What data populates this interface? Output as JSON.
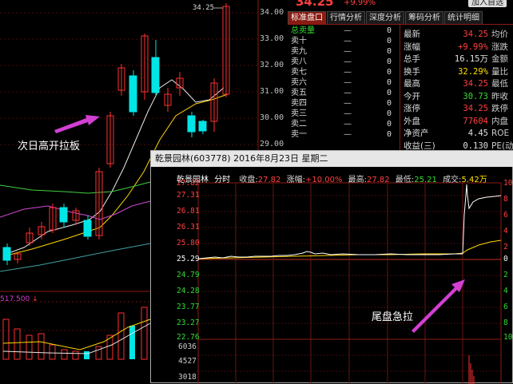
{
  "main_chart": {
    "y_labels": [
      "34.00",
      "33.00",
      "32.00",
      "31.00",
      "30.00",
      "29.00"
    ],
    "peak_label": "34.25",
    "annotation": "次日高开拉板",
    "volume_label": "517.500",
    "volume_suffix": "↓"
  },
  "header": {
    "price": "34.25",
    "change_pct": "+9.99%",
    "add_btn": "加入自选"
  },
  "tabs": [
    "标准盘口",
    "行情分析",
    "深度分析",
    "筹码分析",
    "统计明细"
  ],
  "order_book": [
    {
      "label": "总卖量",
      "dash": "—",
      "val": "0"
    },
    {
      "label": "卖十",
      "dash": "—",
      "val": "0"
    },
    {
      "label": "卖九",
      "dash": "—",
      "val": "0"
    },
    {
      "label": "卖八",
      "dash": "—",
      "val": "0"
    },
    {
      "label": "卖七",
      "dash": "—",
      "val": "0"
    },
    {
      "label": "卖六",
      "dash": "—",
      "val": "0"
    },
    {
      "label": "卖五",
      "dash": "—",
      "val": "0"
    },
    {
      "label": "卖四",
      "dash": "—",
      "val": "0"
    },
    {
      "label": "卖三",
      "dash": "—",
      "val": "0"
    },
    {
      "label": "卖二",
      "dash": "—",
      "val": "0"
    },
    {
      "label": "卖一",
      "dash": "—",
      "val": "0"
    }
  ],
  "stats": [
    {
      "label": "最新",
      "val": "34.25",
      "color": "#ff4040",
      "tail": "均价"
    },
    {
      "label": "涨幅",
      "val": "+9.99%",
      "color": "#ff4040",
      "tail": "涨跌"
    },
    {
      "label": "总手",
      "val": "16.15万",
      "color": "#e0e0e0",
      "tail": "金额"
    },
    {
      "label": "换手",
      "val": "32.29%",
      "color": "#ffe000",
      "tail": "量比"
    },
    {
      "label": "最高",
      "val": "34.25",
      "color": "#ff4040",
      "tail": "最低"
    },
    {
      "label": "今开",
      "val": "30.73",
      "color": "#33dd33",
      "tail": "昨收"
    },
    {
      "label": "涨停",
      "val": "34.25",
      "color": "#ff4040",
      "tail": "跌停"
    },
    {
      "label": "外盘",
      "val": "77604",
      "color": "#ff4040",
      "tail": "内盘"
    },
    {
      "label": "净资产",
      "val": "4.45",
      "color": "#e0e0e0",
      "tail": "ROE"
    },
    {
      "label": "收益(三)",
      "val": "0.130",
      "color": "#e0e0e0",
      "tail": "PE(动)"
    }
  ],
  "popup": {
    "title": "乾景园林(603778) 2016年8月23日 星期二",
    "info": {
      "name": "乾景园林",
      "mode": "分时",
      "close_label": "收盘:",
      "close_val": "27.82",
      "chg_label": "涨幅:",
      "chg_val": "+10.00%",
      "high_label": "最高:",
      "high_val": "27.82",
      "low_label": "最低:",
      "low_val": "25.21",
      "turnover_label": "成交:",
      "turnover_val": "5.42万"
    },
    "price_labels": [
      "27.82",
      "27.31",
      "26.81",
      "26.31",
      "25.80",
      "25.29",
      "24.79",
      "24.28",
      "23.77",
      "23.27",
      "22.76"
    ],
    "volume_labels": [
      "6036",
      "4527",
      "3018"
    ],
    "right_labels": [
      "10",
      "8",
      "6",
      "4",
      "2",
      "0",
      "2",
      "4",
      "6",
      "8",
      "10"
    ],
    "annotation": "尾盘急拉"
  },
  "colors": {
    "up": "#ff3030",
    "down": "#00e5e5",
    "accent": "#8a1b12"
  }
}
